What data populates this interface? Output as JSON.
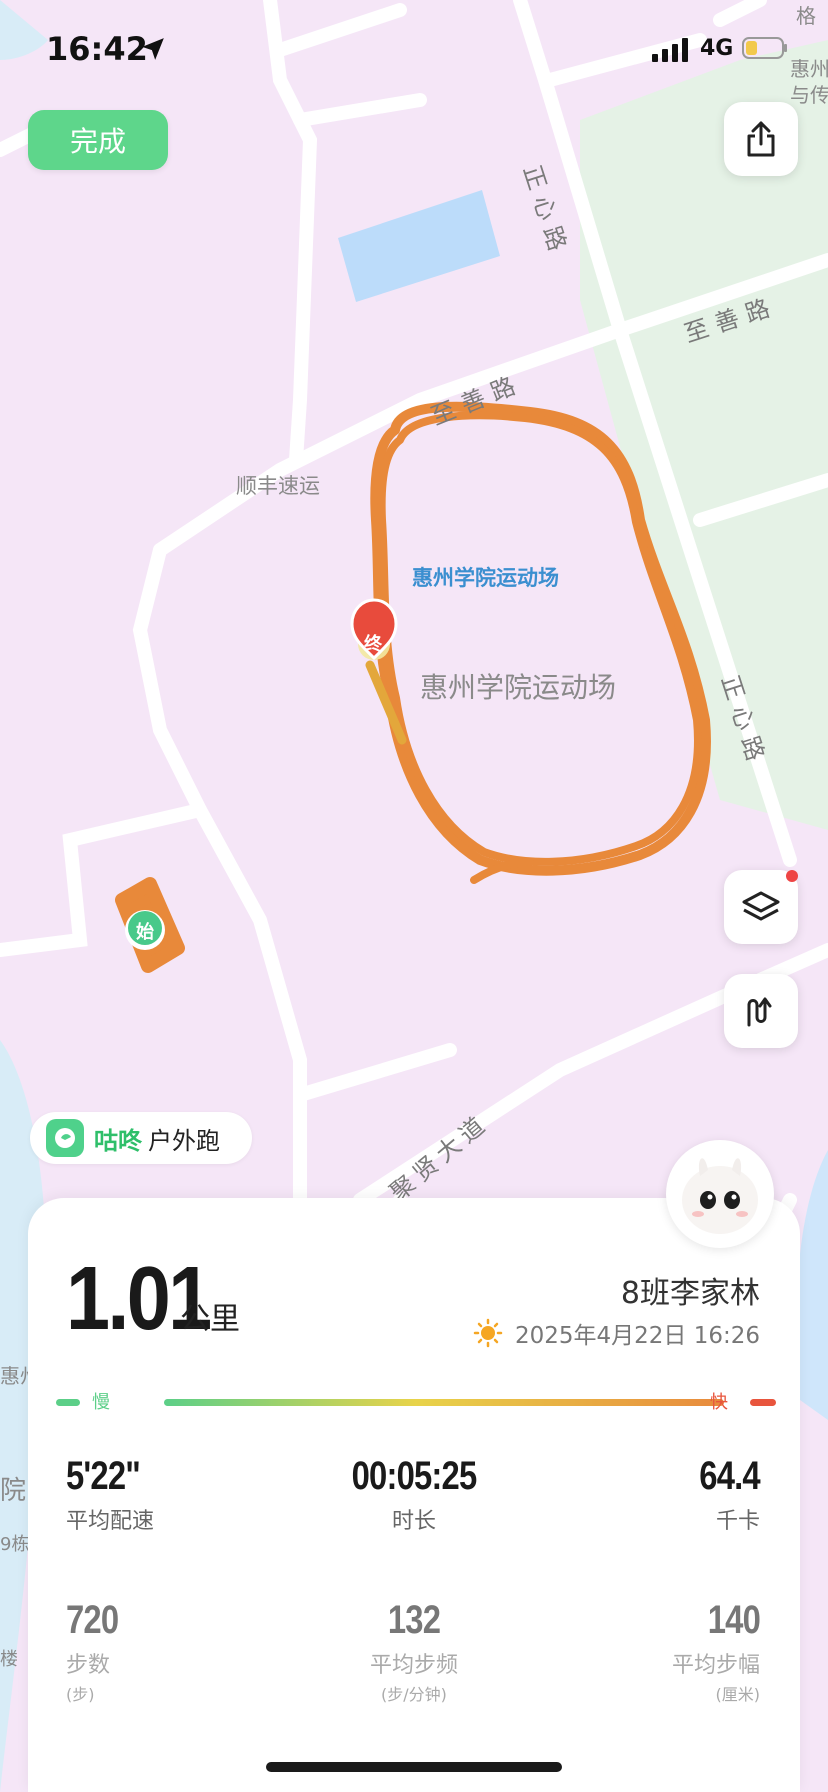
{
  "status_bar": {
    "time": "16:42",
    "network": "4G"
  },
  "done_label": "完成",
  "map": {
    "roads": {
      "zhengxin_top": "正心路",
      "zhishan_right": "至善路",
      "zhishan_mid": "至善路",
      "zhengxin_right": "正心路",
      "juxian": "聚贤大道"
    },
    "poi": {
      "shunfeng": "顺丰速运",
      "stadium_blue": "惠州学院运动场",
      "stadium_gray": "惠州学院运动场",
      "edge_top": "惠州\n与传",
      "edge_left1": "惠州",
      "edge_left2": "院",
      "edge_left3": "9栋",
      "edge_left4": "楼",
      "edge_top2": "格"
    },
    "markers": {
      "end": "终",
      "start": "始"
    }
  },
  "brand": {
    "name": "咕咚",
    "activity": "户外跑"
  },
  "summary": {
    "distance": "1.01",
    "distance_unit": "公里",
    "user": "8班李家林",
    "date": "2025年4月22日 16:26",
    "pace_slow": "慢",
    "pace_fast": "快"
  },
  "stats": [
    {
      "value": "5'22\"",
      "label": "平均配速",
      "unit": ""
    },
    {
      "value": "00:05:25",
      "label": "时长",
      "unit": ""
    },
    {
      "value": "64.4",
      "label": "千卡",
      "unit": ""
    },
    {
      "value": "720",
      "label": "步数",
      "unit": "(步)"
    },
    {
      "value": "132",
      "label": "平均步频",
      "unit": "(步/分钟)"
    },
    {
      "value": "140",
      "label": "平均步幅",
      "unit": "(厘米)"
    }
  ],
  "colors": {
    "accent_green": "#5ed68b",
    "track_orange": "#e8893a",
    "map_bg": "#f5e6f7",
    "park_green": "#e6f3e8"
  },
  "icons": [
    "location-arrow-icon",
    "signal-icon",
    "battery-icon",
    "share-icon",
    "layers-icon",
    "route-icon",
    "sun-icon"
  ]
}
